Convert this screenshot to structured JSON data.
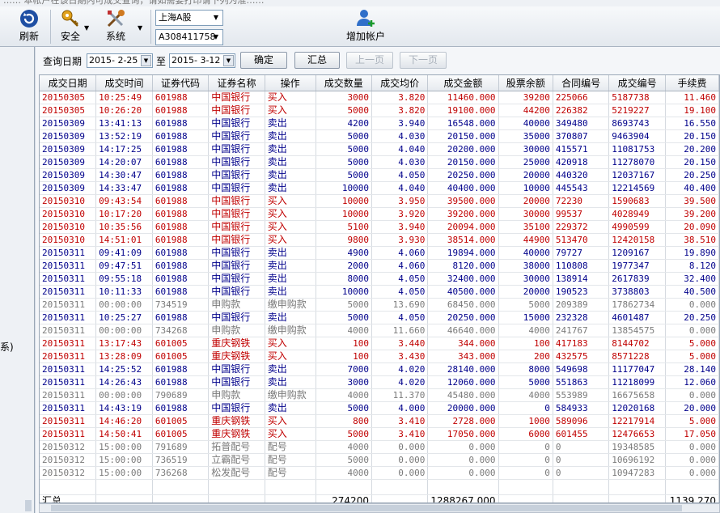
{
  "header": {
    "truncated_text": "…… 本帐户在该日期内可成交查询，请如需要打印请下列为准……"
  },
  "toolbar": {
    "refresh_label": "刷新",
    "security_label": "安全",
    "system_label": "系统",
    "add_account_label": "增加帐户",
    "market_select": "上海A股",
    "account_select": "A308411758"
  },
  "left_panel": {
    "text": "系)"
  },
  "query": {
    "date_label": "查询日期",
    "start_date": "2015- 2-25",
    "to_label": "至",
    "end_date": "2015- 3-12",
    "confirm_label": "确定",
    "summary_label": "汇总",
    "prev_label": "上一页",
    "next_label": "下一页"
  },
  "table": {
    "columns": [
      "成交日期",
      "成交时间",
      "证券代码",
      "证券名称",
      "操作",
      "成交数量",
      "成交均价",
      "成交金额",
      "股票余额",
      "合同编号",
      "成交编号",
      "手续费"
    ],
    "rows": [
      {
        "t": "buy",
        "c": [
          "20150305",
          "10:25:49",
          "601988",
          "中国银行",
          "买入",
          "3000",
          "3.820",
          "11460.000",
          "39200",
          "225066",
          "5187738",
          "11.460"
        ]
      },
      {
        "t": "buy",
        "c": [
          "20150305",
          "10:26:20",
          "601988",
          "中国银行",
          "买入",
          "5000",
          "3.820",
          "19100.000",
          "44200",
          "226382",
          "5219227",
          "19.100"
        ]
      },
      {
        "t": "sell",
        "c": [
          "20150309",
          "13:41:13",
          "601988",
          "中国银行",
          "卖出",
          "4200",
          "3.940",
          "16548.000",
          "40000",
          "349480",
          "8693743",
          "16.550"
        ]
      },
      {
        "t": "sell",
        "c": [
          "20150309",
          "13:52:19",
          "601988",
          "中国银行",
          "卖出",
          "5000",
          "4.030",
          "20150.000",
          "35000",
          "370807",
          "9463904",
          "20.150"
        ]
      },
      {
        "t": "sell",
        "c": [
          "20150309",
          "14:17:25",
          "601988",
          "中国银行",
          "卖出",
          "5000",
          "4.040",
          "20200.000",
          "30000",
          "415571",
          "11081753",
          "20.200"
        ]
      },
      {
        "t": "sell",
        "c": [
          "20150309",
          "14:20:07",
          "601988",
          "中国银行",
          "卖出",
          "5000",
          "4.030",
          "20150.000",
          "25000",
          "420918",
          "11278070",
          "20.150"
        ]
      },
      {
        "t": "sell",
        "c": [
          "20150309",
          "14:30:47",
          "601988",
          "中国银行",
          "卖出",
          "5000",
          "4.050",
          "20250.000",
          "20000",
          "440320",
          "12037167",
          "20.250"
        ]
      },
      {
        "t": "sell",
        "c": [
          "20150309",
          "14:33:47",
          "601988",
          "中国银行",
          "卖出",
          "10000",
          "4.040",
          "40400.000",
          "10000",
          "445543",
          "12214569",
          "40.400"
        ]
      },
      {
        "t": "buy",
        "c": [
          "20150310",
          "09:43:54",
          "601988",
          "中国银行",
          "买入",
          "10000",
          "3.950",
          "39500.000",
          "20000",
          "72230",
          "1590683",
          "39.500"
        ]
      },
      {
        "t": "buy",
        "c": [
          "20150310",
          "10:17:20",
          "601988",
          "中国银行",
          "买入",
          "10000",
          "3.920",
          "39200.000",
          "30000",
          "99537",
          "4028949",
          "39.200"
        ]
      },
      {
        "t": "buy",
        "c": [
          "20150310",
          "10:35:56",
          "601988",
          "中国银行",
          "买入",
          "5100",
          "3.940",
          "20094.000",
          "35100",
          "229372",
          "4990599",
          "20.090"
        ]
      },
      {
        "t": "buy",
        "c": [
          "20150310",
          "14:51:01",
          "601988",
          "中国银行",
          "买入",
          "9800",
          "3.930",
          "38514.000",
          "44900",
          "513470",
          "12420158",
          "38.510"
        ]
      },
      {
        "t": "sell",
        "c": [
          "20150311",
          "09:41:09",
          "601988",
          "中国银行",
          "卖出",
          "4900",
          "4.060",
          "19894.000",
          "40000",
          "79727",
          "1209167",
          "19.890"
        ]
      },
      {
        "t": "sell",
        "c": [
          "20150311",
          "09:47:51",
          "601988",
          "中国银行",
          "卖出",
          "2000",
          "4.060",
          "8120.000",
          "38000",
          "110808",
          "1977347",
          "8.120"
        ]
      },
      {
        "t": "sell",
        "c": [
          "20150311",
          "09:55:18",
          "601988",
          "中国银行",
          "卖出",
          "8000",
          "4.050",
          "32400.000",
          "30000",
          "138914",
          "2617839",
          "32.400"
        ]
      },
      {
        "t": "sell",
        "c": [
          "20150311",
          "10:11:33",
          "601988",
          "中国银行",
          "卖出",
          "10000",
          "4.050",
          "40500.000",
          "20000",
          "190523",
          "3738803",
          "40.500"
        ]
      },
      {
        "t": "misc",
        "c": [
          "20150311",
          "00:00:00",
          "734519",
          "申购款",
          "缴申购款",
          "5000",
          "13.690",
          "68450.000",
          "5000",
          "209389",
          "17862734",
          "0.000"
        ]
      },
      {
        "t": "sell",
        "c": [
          "20150311",
          "10:25:27",
          "601988",
          "中国银行",
          "卖出",
          "5000",
          "4.050",
          "20250.000",
          "15000",
          "232328",
          "4601487",
          "20.250"
        ]
      },
      {
        "t": "misc",
        "c": [
          "20150311",
          "00:00:00",
          "734268",
          "申购款",
          "缴申购款",
          "4000",
          "11.660",
          "46640.000",
          "4000",
          "241767",
          "13854575",
          "0.000"
        ]
      },
      {
        "t": "buy",
        "c": [
          "20150311",
          "13:17:43",
          "601005",
          "重庆钢铁",
          "买入",
          "100",
          "3.440",
          "344.000",
          "100",
          "417183",
          "8144702",
          "5.000"
        ]
      },
      {
        "t": "buy",
        "c": [
          "20150311",
          "13:28:09",
          "601005",
          "重庆钢铁",
          "买入",
          "100",
          "3.430",
          "343.000",
          "200",
          "432575",
          "8571228",
          "5.000"
        ]
      },
      {
        "t": "sell",
        "c": [
          "20150311",
          "14:25:52",
          "601988",
          "中国银行",
          "卖出",
          "7000",
          "4.020",
          "28140.000",
          "8000",
          "549698",
          "11177047",
          "28.140"
        ]
      },
      {
        "t": "sell",
        "c": [
          "20150311",
          "14:26:43",
          "601988",
          "中国银行",
          "卖出",
          "3000",
          "4.020",
          "12060.000",
          "5000",
          "551863",
          "11218099",
          "12.060"
        ]
      },
      {
        "t": "misc",
        "c": [
          "20150311",
          "00:00:00",
          "790689",
          "申购款",
          "缴申购款",
          "4000",
          "11.370",
          "45480.000",
          "4000",
          "553989",
          "16675658",
          "0.000"
        ]
      },
      {
        "t": "sell",
        "c": [
          "20150311",
          "14:43:19",
          "601988",
          "中国银行",
          "卖出",
          "5000",
          "4.000",
          "20000.000",
          "0",
          "584933",
          "12020168",
          "20.000"
        ]
      },
      {
        "t": "buy",
        "c": [
          "20150311",
          "14:46:20",
          "601005",
          "重庆钢铁",
          "买入",
          "800",
          "3.410",
          "2728.000",
          "1000",
          "589096",
          "12217914",
          "5.000"
        ]
      },
      {
        "t": "buy",
        "c": [
          "20150311",
          "14:50:41",
          "601005",
          "重庆钢铁",
          "买入",
          "5000",
          "3.410",
          "17050.000",
          "6000",
          "601455",
          "12476653",
          "17.050"
        ]
      },
      {
        "t": "misc",
        "c": [
          "20150312",
          "15:00:00",
          "791689",
          "拓普配号",
          "配号",
          "4000",
          "0.000",
          "0.000",
          "0",
          "0",
          "19348585",
          "0.000"
        ]
      },
      {
        "t": "misc",
        "c": [
          "20150312",
          "15:00:00",
          "736519",
          "立霸配号",
          "配号",
          "5000",
          "0.000",
          "0.000",
          "0",
          "0",
          "10696192",
          "0.000"
        ]
      },
      {
        "t": "misc",
        "c": [
          "20150312",
          "15:00:00",
          "736268",
          "松发配号",
          "配号",
          "4000",
          "0.000",
          "0.000",
          "0",
          "0",
          "10947283",
          "0.000"
        ]
      }
    ],
    "total": {
      "label": "汇总",
      "quantity": "274200",
      "amount": "1288267.000",
      "fee": "1139.270"
    }
  },
  "colors": {
    "buy": "#c00000",
    "sell": "#00008b",
    "misc": "#7a7a7a",
    "accent": "#1f4fa3"
  },
  "icons": [
    "refresh-icon",
    "security-key-icon",
    "system-tools-icon",
    "add-user-icon"
  ]
}
